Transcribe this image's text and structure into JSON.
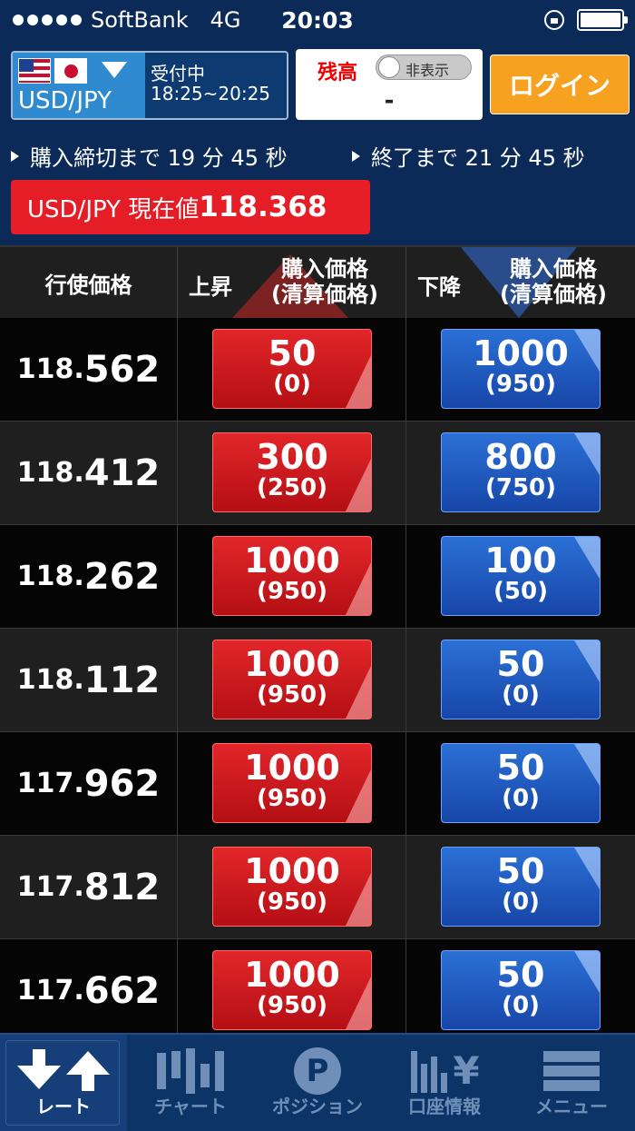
{
  "status": {
    "carrier": "SoftBank",
    "network": "4G",
    "time": "20:03"
  },
  "header": {
    "pair": "USD/JPY",
    "accept_status": "受付中",
    "accept_hours": "18:25~20:25",
    "balance_label": "残高",
    "toggle_label": "非表示",
    "balance_value": "-",
    "login_label": "ログイン"
  },
  "countdown": {
    "purchase_deadline": "購入締切まで 19 分 45 秒",
    "end": "終了まで 21 分 45 秒"
  },
  "current_rate": {
    "label": "USD/JPY 現在値",
    "value": "118.368"
  },
  "table": {
    "col_strike": "行使価格",
    "col_up": "上昇",
    "col_down": "下降",
    "col_price_line1": "購入価格",
    "col_price_line2": "(清算価格)",
    "rows": [
      {
        "strike_int": "118.",
        "strike_dec": "562",
        "up_price": "50",
        "up_settle": "(0)",
        "down_price": "1000",
        "down_settle": "(950)"
      },
      {
        "strike_int": "118.",
        "strike_dec": "412",
        "up_price": "300",
        "up_settle": "(250)",
        "down_price": "800",
        "down_settle": "(750)"
      },
      {
        "strike_int": "118.",
        "strike_dec": "262",
        "up_price": "1000",
        "up_settle": "(950)",
        "down_price": "100",
        "down_settle": "(50)"
      },
      {
        "strike_int": "118.",
        "strike_dec": "112",
        "up_price": "1000",
        "up_settle": "(950)",
        "down_price": "50",
        "down_settle": "(0)"
      },
      {
        "strike_int": "117.",
        "strike_dec": "962",
        "up_price": "1000",
        "up_settle": "(950)",
        "down_price": "50",
        "down_settle": "(0)"
      },
      {
        "strike_int": "117.",
        "strike_dec": "812",
        "up_price": "1000",
        "up_settle": "(950)",
        "down_price": "50",
        "down_settle": "(0)"
      },
      {
        "strike_int": "117.",
        "strike_dec": "662",
        "up_price": "1000",
        "up_settle": "(950)",
        "down_price": "50",
        "down_settle": "(0)"
      }
    ]
  },
  "tabs": [
    {
      "label": "レート",
      "icon": "rate-arrows-icon",
      "active": true
    },
    {
      "label": "チャート",
      "icon": "candlestick-icon",
      "active": false
    },
    {
      "label": "ポジション",
      "icon": "position-p-icon",
      "active": false
    },
    {
      "label": "口座情報",
      "icon": "account-yen-icon",
      "active": false
    },
    {
      "label": "メニュー",
      "icon": "menu-icon",
      "active": false
    }
  ],
  "colors": {
    "background": "#0b2a57",
    "up": "#e2262a",
    "down": "#2b70d6",
    "login": "#f6a11f"
  }
}
